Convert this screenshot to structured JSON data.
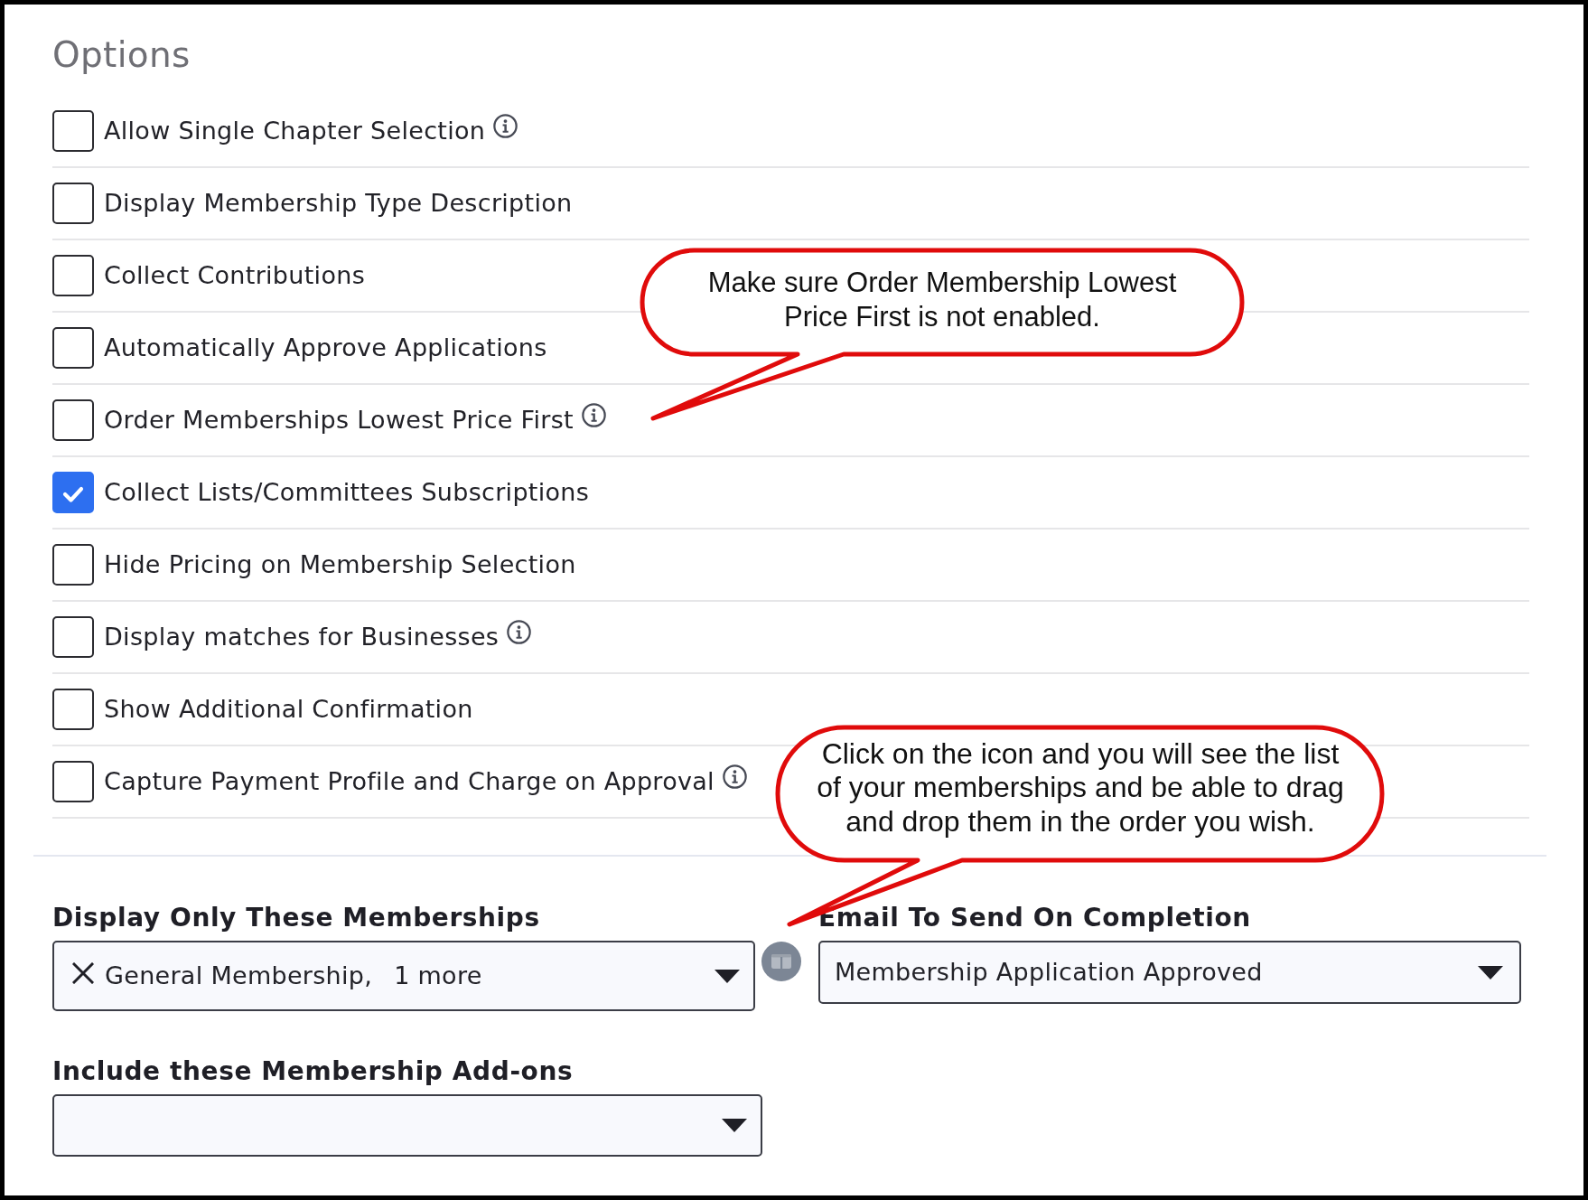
{
  "section_title": "Options",
  "options": [
    {
      "label": "Allow Single Chapter Selection",
      "checked": false,
      "info": true
    },
    {
      "label": "Display Membership Type Description",
      "checked": false,
      "info": false
    },
    {
      "label": "Collect Contributions",
      "checked": false,
      "info": false
    },
    {
      "label": "Automatically Approve Applications",
      "checked": false,
      "info": false
    },
    {
      "label": "Order Memberships Lowest Price First",
      "checked": false,
      "info": true
    },
    {
      "label": "Collect Lists/Committees Subscriptions",
      "checked": true,
      "info": false
    },
    {
      "label": "Hide Pricing on Membership Selection",
      "checked": false,
      "info": false
    },
    {
      "label": "Display matches for Businesses",
      "checked": false,
      "info": true
    },
    {
      "label": "Show Additional Confirmation",
      "checked": false,
      "info": false
    },
    {
      "label": "Capture Payment Profile and Charge on Approval",
      "checked": false,
      "info": true
    }
  ],
  "display_only_memberships": {
    "label": "Display Only These Memberships",
    "value": "General Membership,",
    "more_label": "1 more"
  },
  "email_on_completion": {
    "label": "Email To Send On Completion",
    "value": "Membership Application Approved"
  },
  "membership_add_ons": {
    "label": "Include these Membership Add-ons"
  },
  "annotations": [
    {
      "text": "Make sure Order Membership Lowest Price First is not enabled."
    },
    {
      "text": "Click on the icon and you will see the list of your memberships and be able to drag and drop them in the order you wish."
    }
  ]
}
